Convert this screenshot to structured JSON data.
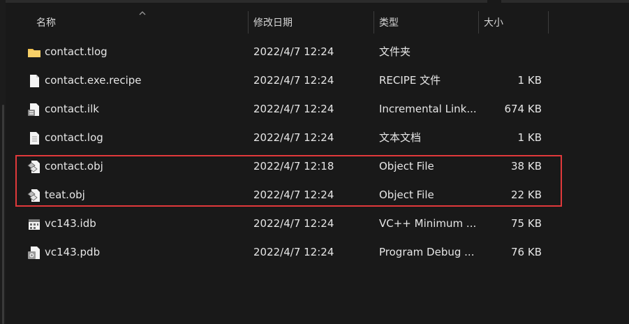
{
  "columns": {
    "name": "名称",
    "modified": "修改日期",
    "type": "类型",
    "size": "大小"
  },
  "files": [
    {
      "name": "contact.tlog",
      "modified": "2022/4/7 12:24",
      "type": "文件夹",
      "size": "",
      "icon": "folder-icon"
    },
    {
      "name": "contact.exe.recipe",
      "modified": "2022/4/7 12:24",
      "type": "RECIPE 文件",
      "size": "1 KB",
      "icon": "blank-file-icon"
    },
    {
      "name": "contact.ilk",
      "modified": "2022/4/7 12:24",
      "type": "Incremental Link...",
      "size": "674 KB",
      "icon": "ilk-file-icon"
    },
    {
      "name": "contact.log",
      "modified": "2022/4/7 12:24",
      "type": "文本文档",
      "size": "1 KB",
      "icon": "text-file-icon"
    },
    {
      "name": "contact.obj",
      "modified": "2022/4/7 12:18",
      "type": "Object File",
      "size": "38 KB",
      "icon": "object-file-icon"
    },
    {
      "name": "teat.obj",
      "modified": "2022/4/7 12:24",
      "type": "Object File",
      "size": "22 KB",
      "icon": "object-file-icon"
    },
    {
      "name": "vc143.idb",
      "modified": "2022/4/7 12:24",
      "type": "VC++ Minimum ...",
      "size": "75 KB",
      "icon": "idb-file-icon"
    },
    {
      "name": "vc143.pdb",
      "modified": "2022/4/7 12:24",
      "type": "Program Debug ...",
      "size": "76 KB",
      "icon": "pdb-file-icon"
    }
  ],
  "colors": {
    "background": "#191919",
    "text": "#e6e6e6",
    "highlight": "#e0393b",
    "folder": "#f2c14e"
  }
}
